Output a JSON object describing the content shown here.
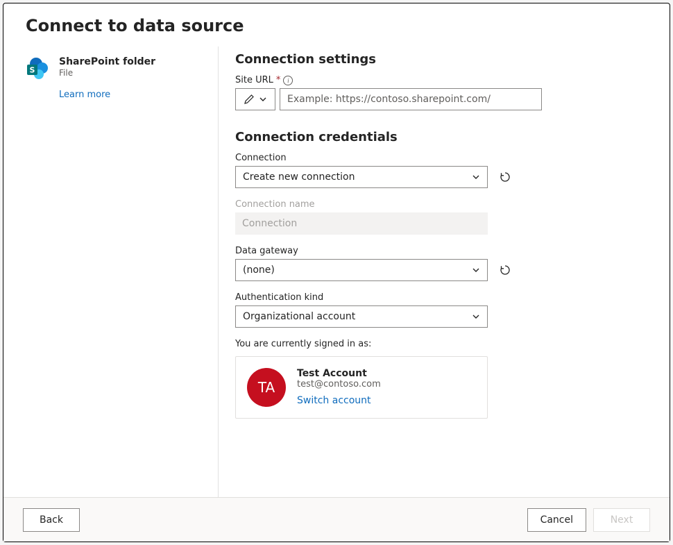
{
  "title": "Connect to data source",
  "source": {
    "name": "SharePoint folder",
    "subtitle": "File",
    "learn_more": "Learn more"
  },
  "settings": {
    "heading": "Connection settings",
    "site_url_label": "Site URL",
    "site_url_placeholder": "Example: https://contoso.sharepoint.com/"
  },
  "credentials": {
    "heading": "Connection credentials",
    "connection_label": "Connection",
    "connection_value": "Create new connection",
    "connection_name_label": "Connection name",
    "connection_name_value": "Connection",
    "gateway_label": "Data gateway",
    "gateway_value": "(none)",
    "auth_label": "Authentication kind",
    "auth_value": "Organizational account",
    "signed_in_text": "You are currently signed in as:"
  },
  "account": {
    "initials": "TA",
    "name": "Test Account",
    "email": "test@contoso.com",
    "switch_label": "Switch account"
  },
  "footer": {
    "back": "Back",
    "cancel": "Cancel",
    "next": "Next"
  }
}
